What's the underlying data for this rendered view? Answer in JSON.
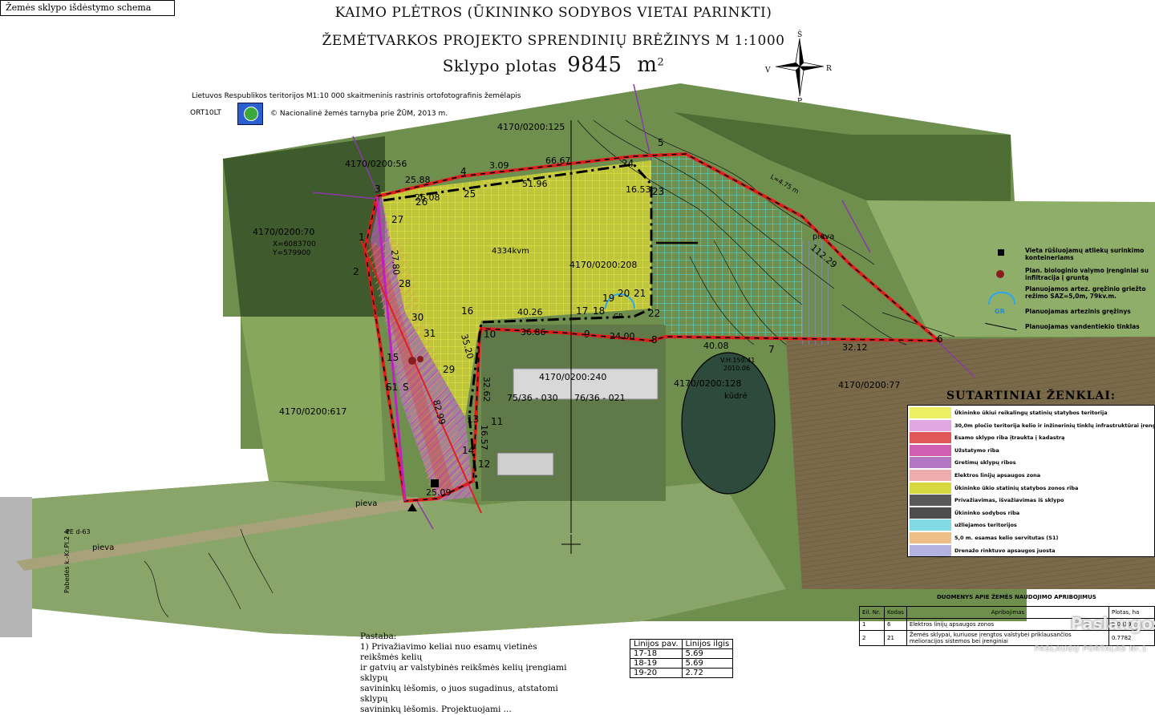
{
  "schema_label": "Žemės sklypo išdėstymo schema",
  "title": {
    "line1": "KAIMO PLĖTROS (ŪKININKO SODYBOS VIETAI PARINKTI)",
    "line2": "ŽEMĖTVARKOS PROJEKTO SPRENDINIŲ BRĖŽINYS M 1:1000",
    "area_prefix": "Sklypo plotas",
    "area_value": "9845",
    "area_unit": "m",
    "area_sup": "2"
  },
  "compass": {
    "n": "Š",
    "s": "P",
    "w": "V",
    "e": "R"
  },
  "source": {
    "line1": "Lietuvos Respublikos teritorijos M1:10 000 skaitmeninis rastrinis ortofotografinis žemėlapis",
    "code": "ORT10LT",
    "copyright": "© Nacionalinė žemės tarnyba prie ŽŪM, 2013 m."
  },
  "parcels": {
    "p125": "4170/0200:125",
    "p56": "4170/0200:56",
    "p70": "4170/0200:70",
    "p208": "4170/0200:208",
    "p240": "4170/0200:240",
    "p128": "4170/0200:128",
    "p77": "4170/0200:77",
    "p617": "4170/0200:617"
  },
  "map_labels": {
    "area_kvm": "4334kvm",
    "x_coord": "X=6083700",
    "y_coord": "Y=579900",
    "pieva1": "pieva",
    "pieva2": "pieva",
    "pieva3": "pieva",
    "kudre": "kūdrė",
    "vh": "V.H.159.41",
    "vh_year": "2010.06",
    "block1": "75/36 - 030",
    "block2": "76/36 - 021",
    "s1": "S1",
    "s": "S",
    "gr": "GR",
    "road": "Pabedės k.-Kr.Pl.2 A",
    "pe": "PE d-63",
    "line_len": "L=4.75 m"
  },
  "points": [
    "1",
    "2",
    "3",
    "4",
    "5",
    "6",
    "7",
    "8",
    "9",
    "10",
    "11",
    "12",
    "13",
    "14",
    "15",
    "16",
    "17",
    "18",
    "19",
    "20",
    "21",
    "22",
    "23",
    "24",
    "25",
    "26",
    "27",
    "28",
    "29",
    "30",
    "31"
  ],
  "distances": {
    "d1": "51.96",
    "d2": "66.67",
    "d3": "25.88",
    "d4": "3.09",
    "d5": "40.26",
    "d6": "36.86",
    "d7": "24.00",
    "d8": "40.08",
    "d9": "32.12",
    "d10": "112.29",
    "d11": "16.53",
    "d12": "26.08",
    "d13": "32.62",
    "d14": "16.57",
    "d15": "25.09",
    "d16": "82.99",
    "d17": "35.20",
    "d18": "27.80"
  },
  "right_legend": [
    {
      "icon": "square",
      "text": "Vieta rūšiuojamų atliekų surinkimo konteineriams"
    },
    {
      "icon": "dot",
      "text": "Plan. biologinio valymo įrenginiai su infiltracija į gruntą"
    },
    {
      "icon": "arc",
      "text": "Planuojamos artez. gręžinio griežto režimo SAZ=5,0m, 79kv.m."
    },
    {
      "icon": "gr",
      "text": "Planuojamas artezinis gręžinys"
    },
    {
      "icon": "line",
      "text": "Planuojamas vandentiekio tinklas"
    }
  ],
  "legend_title": "SUTARTINIAI ŽENKLAI:",
  "legend": [
    {
      "color": "#e7ea2e",
      "text": "Ūkininko ūkiui reikalingų statinių statybos teritorija"
    },
    {
      "color": "#d78ad9",
      "text": "30,0m pločio teritorija kelio ir inžinerinių tinklų infrastruktūrai įrengti (II)"
    },
    {
      "color": "#d62020",
      "text": "Esamo sklypo riba įtraukta į kadastrą"
    },
    {
      "color": "#c02a9a",
      "text": "Užstatymo riba"
    },
    {
      "color": "#9a4ab0",
      "text": "Gretimų sklypų ribos"
    },
    {
      "color": "#e89090",
      "text": "Elektros linijų apsaugos zona"
    },
    {
      "color": "#c9c900",
      "text": "Ūkininko ūkio statinių statybos zonos riba"
    },
    {
      "color": "#222222",
      "text": "Privažiavimas, išvažiavimas iš sklypo"
    },
    {
      "color": "#111111",
      "text": "Ūkininko sodybos riba"
    },
    {
      "color": "#56d0d8",
      "text": "užliejamos teritorijos"
    },
    {
      "color": "#e8a860",
      "text": "5,0 m. esamas kelio servitutas (S1)"
    },
    {
      "color": "#9a9ad8",
      "text": "Drenažo rinktuvo apsaugos juosta"
    }
  ],
  "note": {
    "heading": "Pastaba:",
    "lines": [
      "1) Privažiavimo keliai nuo esamų vietinės reikšmės kelių",
      "ir gatvių ar valstybinės reikšmės kelių įrengiami sklypų",
      "savininkų lėšomis, o juos sugadinus, atstatomi sklypų",
      "savininkų lėšomis. Projektuojami ..."
    ]
  },
  "line_table": {
    "headers": [
      "Linijos pav.",
      "Linijos ilgis"
    ],
    "rows": [
      [
        "17-18",
        "5.69"
      ],
      [
        "18-19",
        "5.69"
      ],
      [
        "19-20",
        "2.72"
      ]
    ]
  },
  "restrictions": {
    "title": "DUOMENYS APIE ŽEMĖS NAUDOJIMO APRIBOJIMUS",
    "headers": [
      "Eil. Nr.",
      "Kodas",
      "Apribojimas",
      "Plotas, ha"
    ],
    "rows": [
      [
        "1",
        "6",
        "Elektros linijų apsaugos zonos",
        "0.0339"
      ],
      [
        "2",
        "21",
        "Žemės sklypai, kuriuose įrengtos valstybei priklausančios melioracijos sistemos bei įrenginiai",
        "0.7782"
      ]
    ]
  },
  "watermark": {
    "brand": "Paslaugos.lt",
    "sub": "PASLAUGŲ PORTALAS  Nr.1"
  }
}
